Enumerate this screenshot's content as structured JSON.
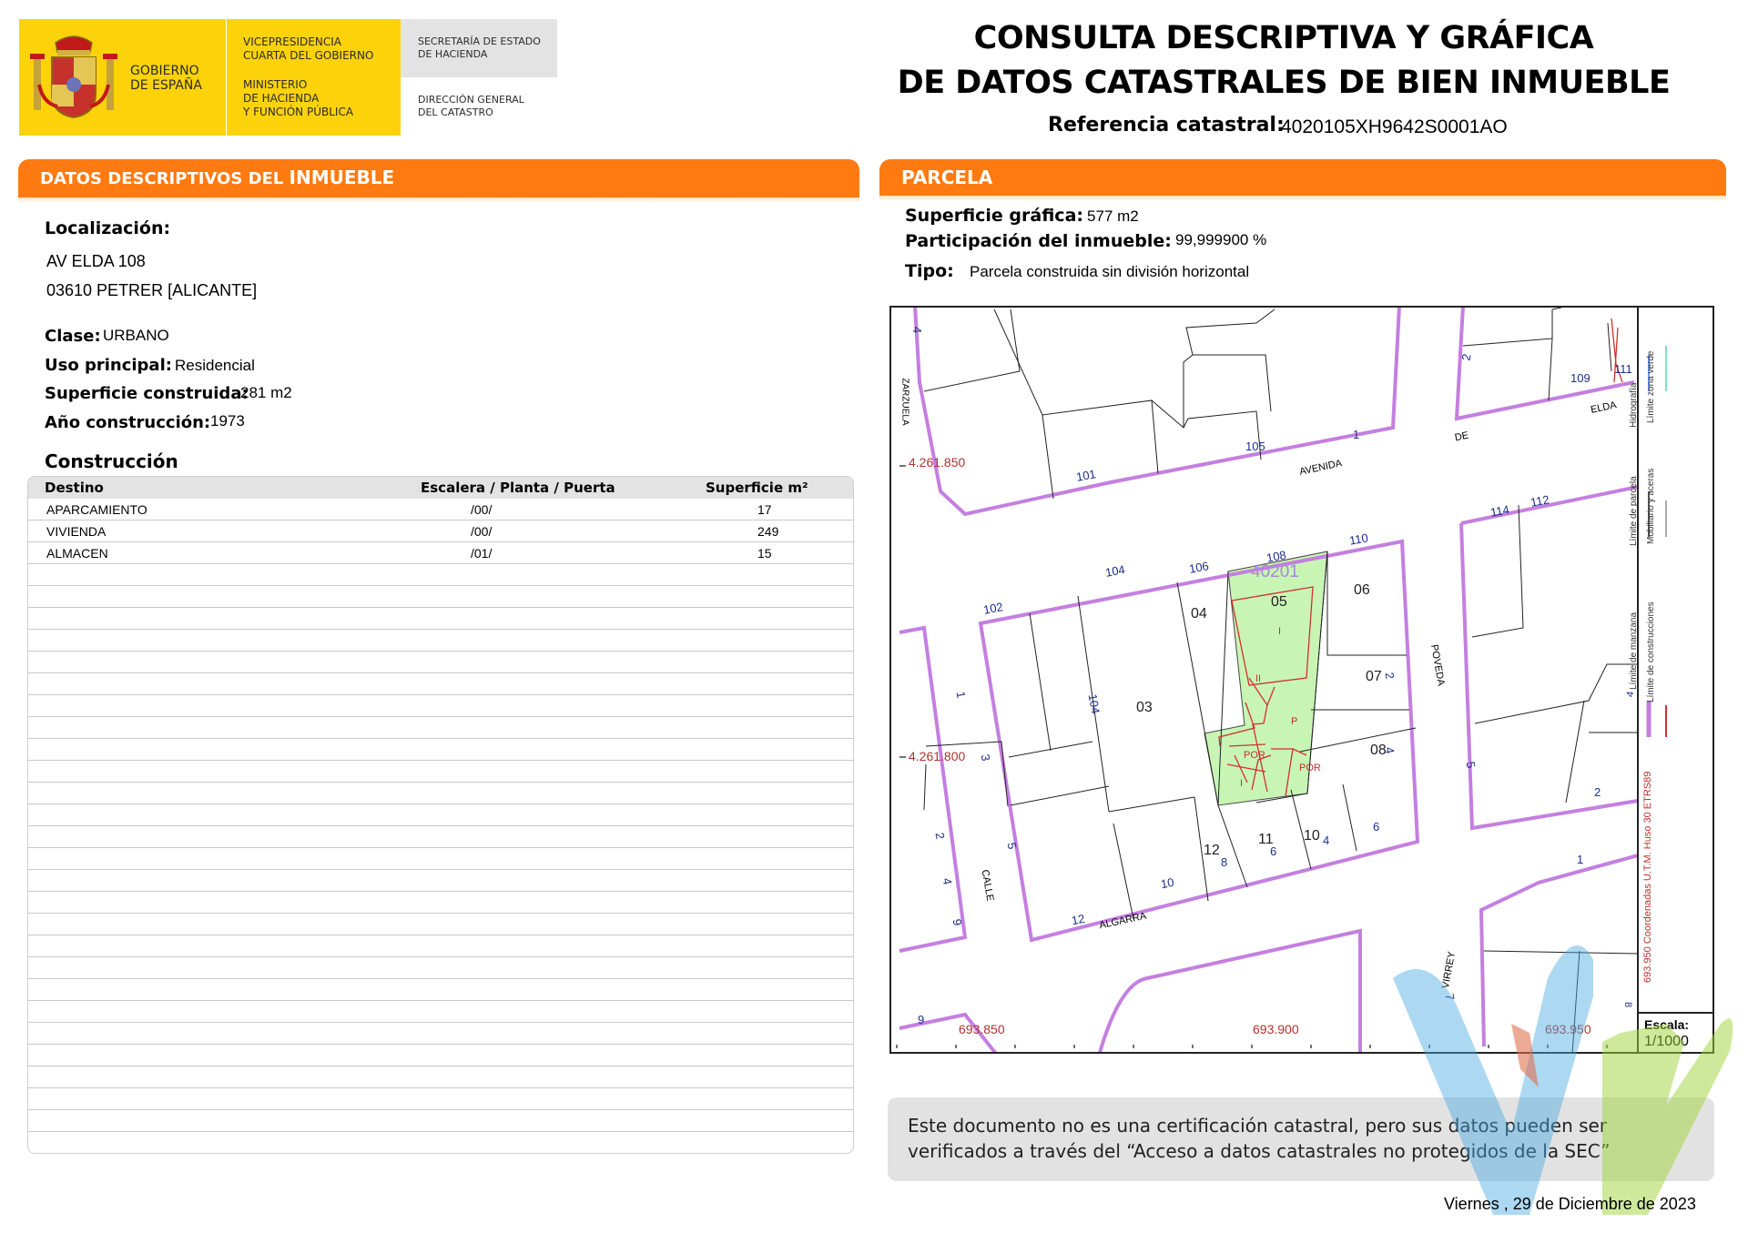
{
  "header": {
    "gov_line1": "GOBIERNO",
    "gov_line2": "DE ESPAÑA",
    "vice_line1": "VICEPRESIDENCIA",
    "vice_line2": "CUARTA DEL GOBIERNO",
    "min_line1": "MINISTERIO",
    "min_line2": "DE HACIENDA",
    "min_line3": "Y FUNCIÓN PÚBLICA",
    "sec_line1": "SECRETARÍA DE ESTADO",
    "sec_line2": "DE HACIENDA",
    "dir_line1": "DIRECCIÓN GENERAL",
    "dir_line2": "DEL CATASTRO",
    "title_line1": "CONSULTA DESCRIPTIVA Y GRÁFICA",
    "title_line2": "DE DATOS CATASTRALES DE BIEN INMUEBLE",
    "ref_label": "Referencia catastral:",
    "ref_value": "4020105XH9642S0001AO"
  },
  "left_section": {
    "bar_title_a": "DATOS DESCRIPTIVOS DEL ",
    "bar_title_b": "INMUEBLE",
    "loc_label": "Localización:",
    "loc_line1": "AV ELDA 108",
    "loc_line2": "03610 PETRER [ALICANTE]",
    "clase_label": "Clase:",
    "clase_value": "URBANO",
    "uso_label": "Uso principal:",
    "uso_value": "Residencial",
    "sup_label": "Superficie construida:",
    "sup_value": "281 m2",
    "anio_label": "Año construcción:",
    "anio_value": "1973",
    "construccion_title": "Construcción",
    "table": {
      "headers": [
        "Destino",
        "Escalera / Planta / Puerta",
        "Superficie m²"
      ],
      "rows": [
        [
          "APARCAMIENTO",
          "/00/",
          "17"
        ],
        [
          "VIVIENDA",
          "/00/",
          "249"
        ],
        [
          "ALMACEN",
          "/01/",
          "15"
        ]
      ]
    }
  },
  "right_section": {
    "bar_title": "PARCELA",
    "supg_label": "Superficie gráfica:",
    "supg_value": "577 m2",
    "part_label": "Participación del inmueble:",
    "part_value": "99,999900 %",
    "tipo_label": "Tipo:",
    "tipo_value": "Parcela construida sin división horizontal"
  },
  "map": {
    "parcel_id": "40201",
    "coord_y1": "4.261.850",
    "coord_y2": "4.261.800",
    "coord_x1": "693.850",
    "coord_x2": "693.900",
    "coord_x3": "693.950",
    "legend_hidro": "Hidrografía",
    "legend_verde": "Límite zona verde",
    "legend_parcela": "Límite de parcela",
    "legend_mobiliario": "Mobiliario y aceras",
    "legend_manzana": "Límite de manzana",
    "legend_construcciones": "Límite de construcciones",
    "coords_note": "693.950 Coordenadas U.T.M. Huso 30 ETRS89",
    "escala_label": "Escala:",
    "escala_value": "1/1000",
    "street_avenida": "AVENIDA",
    "street_de": "DE",
    "street_elda": "ELDA",
    "street_poveda": "POVEDA",
    "street_calle": "CALLE",
    "street_algarra": "ALGARRA",
    "street_virrey": "VIRREY",
    "street_zarzuela": "ZARZUELA",
    "numbers": {
      "n101": "101",
      "n105": "105",
      "n1": "1",
      "n109": "109",
      "n111": "111",
      "n2": "2",
      "n4": "4",
      "n102": "102",
      "n104": "104",
      "n106": "106",
      "n108": "108",
      "n110": "110",
      "n114": "114",
      "n112": "112",
      "p03": "03",
      "p04": "04",
      "p05": "05",
      "p06": "06",
      "p07": "07",
      "p08": "08",
      "p10": "10",
      "p11": "11",
      "p12": "12",
      "s10": "10",
      "s12": "12",
      "s8": "8",
      "s6": "6",
      "s4": "4",
      "s6b": "6",
      "s1": "1",
      "s3": "3",
      "s5": "5",
      "s2": "2",
      "s4b": "4",
      "s9": "9",
      "s7": "7",
      "s2b": "2",
      "s5b": "5",
      "s104": "104",
      "s1b": "1",
      "s2c": "2",
      "s4c": "4",
      "s9b": "9",
      "s8b": "8",
      "s4d": "4"
    },
    "labels": {
      "I1": "I",
      "II": "II",
      "P": "P",
      "POR1": "POR",
      "POR2": "POR",
      "I2": "I"
    }
  },
  "footer": {
    "disclaimer": "Este documento no es una certificación catastral, pero sus datos pueden ser verificados a través del “Acceso a datos catastrales no protegidos de la SEC”",
    "date": "Viernes , 29 de Diciembre de 2023"
  },
  "colors": {
    "orange": "#ff7a10",
    "yellow": "#fcd20a",
    "manzana": "#c47fe0",
    "parcel_fill": "#c8f5b4",
    "construction": "#d03030",
    "coords": "#b03030"
  }
}
